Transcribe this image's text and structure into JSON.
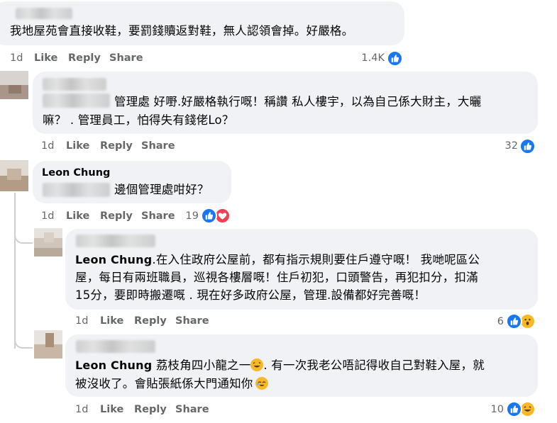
{
  "comments": [
    {
      "id": "c1",
      "author": "",
      "lines": [
        "我地屋苑會直接收鞋，要罰錢贖返對鞋，無人認領會掉。好嚴格。"
      ],
      "time": "1d",
      "like": "Like",
      "reply": "Reply",
      "share": "Share",
      "reaction_count": "1.4K",
      "reactions": [
        "like-icon"
      ]
    },
    {
      "id": "c2",
      "author": "",
      "lines": [
        "管理處 好嘢.好嚴格執行嘅！稱讚 私人樓宇，以為自己係大財主，大曬",
        "嘛？ . 管理員工，怕得失有錢佬Lo？"
      ],
      "time": "1d",
      "like": "Like",
      "reply": "Reply",
      "share": "Share",
      "reaction_count": "32",
      "reactions": [
        "like-icon"
      ]
    },
    {
      "id": "c3",
      "author": "Leon Chung",
      "lines": [
        "邊個管理處咁好？"
      ],
      "time": "1d",
      "like": "Like",
      "reply": "Reply",
      "share": "Share",
      "reaction_count": "19",
      "reactions": [
        "like-icon",
        "heart-icon"
      ]
    },
    {
      "id": "r1",
      "mention": "Leon Chung",
      "lines": [
        ".在入住政府公屋前，都有指示規則要住戶遵守嘅！ 我哋呢區公",
        "屋，每日有兩班職員，巡視各樓層嘅！住戶初犯，口頭警告，再犯扣分，扣滿",
        "15分，要即時搬遷嘅 . 現在好多政府公屋，管理.設備都好完善嘅！"
      ],
      "time": "1d",
      "like": "Like",
      "reply": "Reply",
      "share": "Share",
      "reaction_count": "6",
      "reactions": [
        "like-icon",
        "wow-icon"
      ]
    },
    {
      "id": "r2",
      "mention": "Leon Chung",
      "line1_a": " 荔枝角四小龍之一",
      "line1_b": ". 有一次我老公唔記得收自己對鞋入屋，就",
      "line2": "被沒收了。會貼張紙係大門通知你",
      "time": "1d",
      "like": "Like",
      "reply": "Reply",
      "share": "Share",
      "reaction_count": "10",
      "reactions": [
        "like-icon",
        "haha-icon"
      ]
    }
  ],
  "colors": {
    "bubble": "#f0f2f5",
    "like_blue": "#1877f2",
    "heart_red": "#f33e58",
    "muted": "#65676b"
  }
}
